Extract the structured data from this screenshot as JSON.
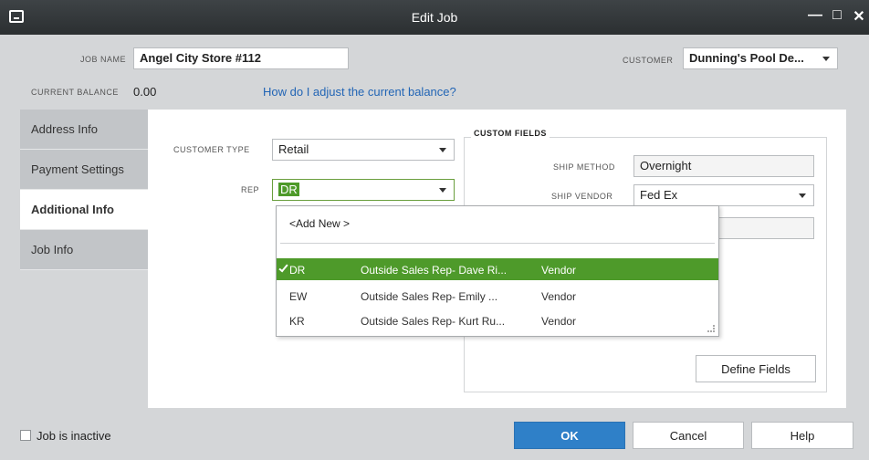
{
  "window": {
    "title": "Edit Job",
    "minimize_glyph": "—",
    "maximize_glyph": "□",
    "close_glyph": "✕"
  },
  "job": {
    "job_name_label": "JOB NAME",
    "job_name_value": "Angel City Store #112",
    "customer_label": "CUSTOMER",
    "customer_value": "Dunning's Pool De...",
    "current_balance_label": "CURRENT BALANCE",
    "current_balance_value": "0.00",
    "adjust_balance_link": "How do I adjust the current balance?"
  },
  "tabs": [
    {
      "label": "Address Info"
    },
    {
      "label": "Payment Settings"
    },
    {
      "label": "Additional Info"
    },
    {
      "label": "Job Info"
    }
  ],
  "additional_info": {
    "customer_type_label": "CUSTOMER TYPE",
    "customer_type_value": "Retail",
    "rep_label": "REP",
    "rep_value": "DR"
  },
  "rep_dropdown": {
    "add_new": "<Add New >",
    "rows": [
      {
        "code": "DR",
        "name": "Outside Sales Rep- Dave Ri...",
        "type": "Vendor"
      },
      {
        "code": "EW",
        "name": "Outside Sales Rep- Emily ...",
        "type": "Vendor"
      },
      {
        "code": "KR",
        "name": "Outside Sales Rep- Kurt Ru...",
        "type": "Vendor"
      }
    ]
  },
  "custom_fields": {
    "title": "CUSTOM FIELDS",
    "ship_method_label": "SHIP METHOD",
    "ship_method_value": "Overnight",
    "ship_vendor_label": "SHIP VENDOR",
    "ship_vendor_value": "Fed Ex",
    "define_fields_button": "Define Fields"
  },
  "footer": {
    "job_inactive_label": "Job is inactive",
    "ok_button": "OK",
    "cancel_button": "Cancel",
    "help_button": "Help"
  },
  "colors": {
    "titlebar": "#2b2f31",
    "selection_green": "#4e9a2a",
    "primary_blue": "#2f80c8",
    "link_blue": "#2265b5"
  }
}
